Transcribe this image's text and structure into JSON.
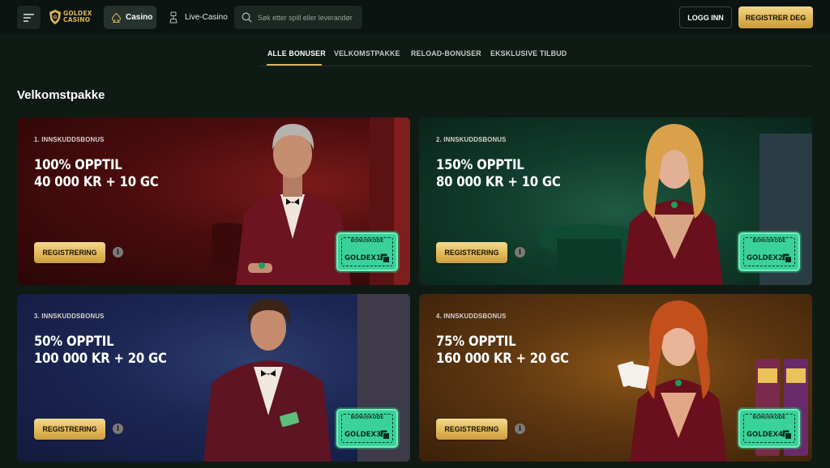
{
  "header": {
    "logo_line1": "GOLDEX",
    "logo_line2": "CASINO",
    "nav_casino": "Casino",
    "nav_live": "Live-Casino",
    "search_placeholder": "Søk etter spill eller leverandør",
    "login_label": "LOGG INN",
    "register_label": "REGISTRER DEG"
  },
  "tabs": [
    {
      "label": "ALLE BONUSER",
      "active": true
    },
    {
      "label": "VELKOMSTPAKKE",
      "active": false
    },
    {
      "label": "RELOAD-BONUSER",
      "active": false
    },
    {
      "label": "EKSKLUSIVE TILBUD",
      "active": false
    }
  ],
  "section_title": "Velkomstpakke",
  "cards": [
    {
      "label": "1. INNSKUDDSBONUS",
      "title_line1": "100% OPPTIL",
      "title_line2": "40 000 KR + 10 GC",
      "button": "REGISTRERING",
      "code_label": "BONUSKODE",
      "code": "GOLDEX1"
    },
    {
      "label": "2. INNSKUDDSBONUS",
      "title_line1": "150% OPPTIL",
      "title_line2": "80 000 KR + 10 GC",
      "button": "REGISTRERING",
      "code_label": "BONUSKODE",
      "code": "GOLDEX2"
    },
    {
      "label": "3. INNSKUDDSBONUS",
      "title_line1": "50% OPPTIL",
      "title_line2": "100 000 KR + 20 GC",
      "button": "REGISTRERING",
      "code_label": "BONUSKODE",
      "code": "GOLDEX3"
    },
    {
      "label": "4. INNSKUDDSBONUS",
      "title_line1": "75% OPPTIL",
      "title_line2": "160 000 KR + 20 GC",
      "button": "REGISTRERING",
      "code_label": "BONUSKODE",
      "code": "GOLDEX4"
    }
  ],
  "info_glyph": "i",
  "colors": {
    "accent_gold": "#d9b45a",
    "code_green": "#3bd19b",
    "background": "#0f1a14"
  }
}
